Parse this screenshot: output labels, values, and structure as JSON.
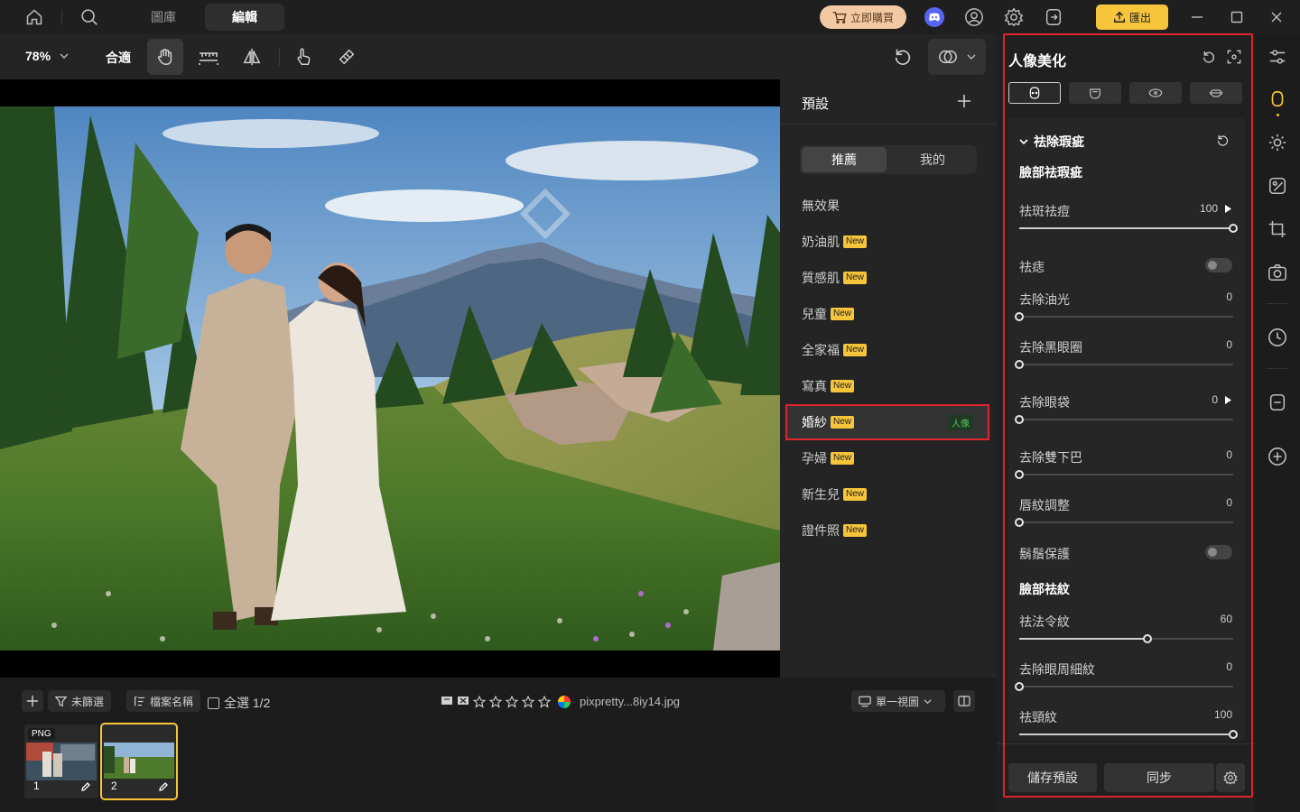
{
  "titlebar": {
    "tabs": [
      {
        "label": "圖庫",
        "active": false
      },
      {
        "label": "編輯",
        "active": true
      }
    ],
    "buy_label": "立即購買",
    "export_label": "匯出"
  },
  "toolbar": {
    "zoom": "78%",
    "fit_label": "合適"
  },
  "presets": {
    "title": "預設",
    "tabs": [
      {
        "label": "推薦",
        "active": true
      },
      {
        "label": "我的",
        "active": false
      }
    ],
    "items": [
      {
        "label": "無效果",
        "new": ""
      },
      {
        "label": "奶油肌",
        "new": "New"
      },
      {
        "label": "質感肌",
        "new": "New"
      },
      {
        "label": "兒童",
        "new": "New"
      },
      {
        "label": "全家福",
        "new": "New"
      },
      {
        "label": "寫真",
        "new": "New"
      },
      {
        "label": "婚紗",
        "new": "New",
        "tag": "人像",
        "selected": true
      },
      {
        "label": "孕婦",
        "new": "New"
      },
      {
        "label": "新生兒",
        "new": "New"
      },
      {
        "label": "證件照",
        "new": "New"
      }
    ]
  },
  "bottom": {
    "filter_label": "未篩選",
    "sort_label": "檔案名稱",
    "select_all_label": "全選 1/2",
    "filename": "pixpretty...8iy14.jpg",
    "view_label": "單一視圖",
    "thumbs": [
      {
        "index": "1",
        "badge": "PNG",
        "selected": false
      },
      {
        "index": "2",
        "badge": "",
        "selected": true
      }
    ]
  },
  "adjust": {
    "title": "人像美化",
    "section_title": "祛除瑕疵",
    "group1_title": "臉部祛瑕疵",
    "group2_title": "臉部祛紋",
    "rows": [
      {
        "label": "祛斑祛痘",
        "value": "100",
        "fraction": 1.0,
        "type": "slider",
        "expand": true
      },
      {
        "label": "祛痣",
        "type": "toggle",
        "on": false
      },
      {
        "label": "去除油光",
        "value": "0",
        "fraction": 0.0,
        "type": "slider"
      },
      {
        "label": "去除黑眼圈",
        "value": "0",
        "fraction": 0.0,
        "type": "slider"
      },
      {
        "label": "去除眼袋",
        "value": "0",
        "fraction": 0.0,
        "type": "slider",
        "expand": true
      },
      {
        "label": "去除雙下巴",
        "value": "0",
        "fraction": 0.0,
        "type": "slider"
      },
      {
        "label": "唇紋調整",
        "value": "0",
        "fraction": 0.0,
        "type": "slider"
      },
      {
        "label": "鬍鬚保護",
        "type": "toggle",
        "on": false
      },
      {
        "label": "祛法令紋",
        "value": "60",
        "fraction": 0.6,
        "type": "slider"
      },
      {
        "label": "去除眼周細紋",
        "value": "0",
        "fraction": 0.0,
        "type": "slider"
      },
      {
        "label": "祛頸紋",
        "value": "100",
        "fraction": 1.0,
        "type": "slider"
      }
    ],
    "save_preset_label": "儲存預設",
    "sync_label": "同步"
  },
  "colors": {
    "accent": "#f6c53b",
    "highlight_border": "#e0242e",
    "buy_bg": "#f3c9a3"
  }
}
